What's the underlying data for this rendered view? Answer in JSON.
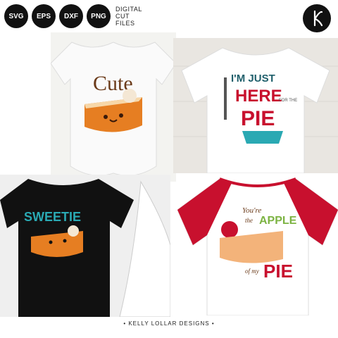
{
  "badges": [
    "SVG",
    "EPS",
    "DXF",
    "PNG"
  ],
  "header": {
    "line1": "DIGITAL",
    "line2": "CUT",
    "line3": "FILES"
  },
  "logo": {
    "letter": "K"
  },
  "designs": [
    {
      "text": "Cute"
    },
    {
      "line1": "I'M JUST",
      "line2": "HERE",
      "line3": "FOR THE",
      "line4": "PIE"
    },
    {
      "text": "SWEETIE"
    },
    {
      "line1": "You're",
      "line2": "the",
      "line3": "APPLE",
      "line4": "of my",
      "line5": "PIE"
    }
  ],
  "footer": "• KELLY LOLLAR DESIGNS •",
  "colors": {
    "orange": "#e67e22",
    "teal": "#2aa9b3",
    "red": "#c8102e",
    "brown": "#6b3b1a"
  }
}
